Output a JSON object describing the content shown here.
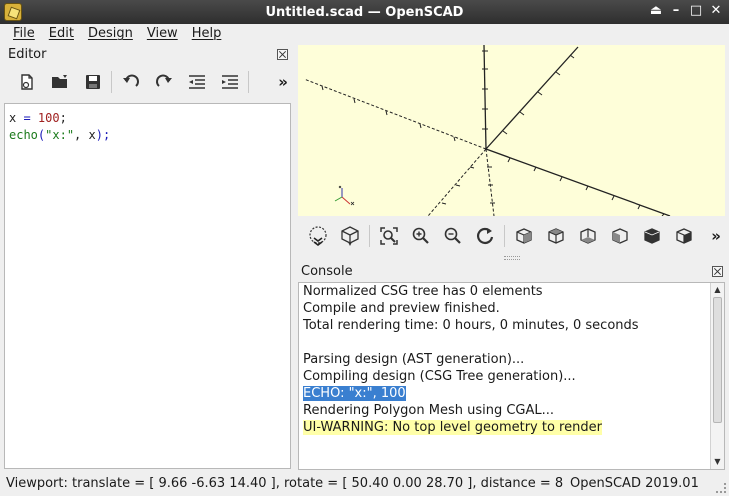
{
  "window": {
    "title": "Untitled.scad — OpenSCAD",
    "controls": [
      "⏏",
      "–",
      "□",
      "✕"
    ]
  },
  "menu": [
    "File",
    "Edit",
    "Design",
    "View",
    "Help"
  ],
  "editor": {
    "title": "Editor",
    "toolbar_icons": [
      "new-file-icon",
      "open-file-icon",
      "save-icon",
      "undo-icon",
      "redo-icon",
      "unindent-icon",
      "indent-icon"
    ],
    "more": "»",
    "code": {
      "line1": {
        "var": "x",
        "op": " = ",
        "num": "100",
        "end": ";"
      },
      "line2": {
        "fn": "echo",
        "open": "(",
        "str": "\"x:\"",
        "comma": ", ",
        "arg": "x",
        "close": ");"
      }
    }
  },
  "view_toolbar": {
    "icons": [
      "preview-icon",
      "render-icon",
      "view-all-icon",
      "zoom-in-icon",
      "zoom-out-icon",
      "reset-view-icon",
      "view-right-icon",
      "view-top-icon",
      "view-bottom-icon",
      "view-left-icon",
      "view-front-icon",
      "view-back-icon"
    ],
    "more": "»"
  },
  "console": {
    "title": "Console",
    "lines": [
      "Normalized CSG tree has 0 elements",
      "Compile and preview finished.",
      "Total rendering time: 0 hours, 0 minutes, 0 seconds",
      "",
      "Parsing design (AST generation)...",
      "Compiling design (CSG Tree generation)...",
      "ECHO: \"x:\", 100",
      "Rendering Polygon Mesh using CGAL...",
      "UI-WARNING: No top level geometry to render"
    ]
  },
  "status": {
    "viewport": "Viewport: translate = [ 9.66 -6.63 14.40 ], rotate = [ 50.40 0.00 28.70 ], distance = 8",
    "version": "OpenSCAD 2019.01"
  },
  "colors": {
    "viewport_bg": "#fefed9",
    "selection": "#3a7fd0",
    "warning_bg": "#ffffa8"
  }
}
